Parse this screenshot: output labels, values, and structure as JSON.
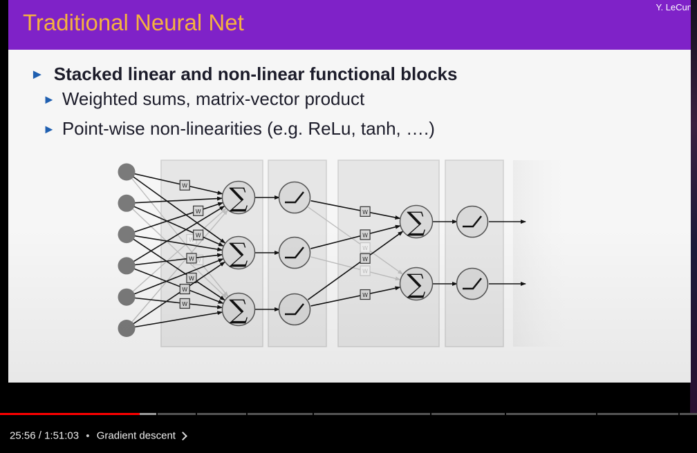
{
  "slide": {
    "title": "Traditional Neural Net",
    "author": "Y. LeCun",
    "bullets": [
      "Stacked linear and non-linear functional blocks",
      "Weighted sums, matrix-vector product",
      "Point-wise non-linearities (e.g. ReLu, tanh, ….)"
    ],
    "diagram": {
      "weight_label": "W",
      "sum_symbol": "∑",
      "input_count": 6,
      "hidden_sum_count": 3,
      "output_sum_count": 2
    }
  },
  "player": {
    "current_time": "25:56",
    "duration": "1:51:03",
    "separator": "•",
    "chapter": "Gradient descent",
    "progress_percent": 20
  },
  "colors": {
    "title_bar": "#7f22c8",
    "title_text": "#f5b23f",
    "bullet_arrow": "#1f5fb0",
    "progress_played": "#ff0000"
  }
}
